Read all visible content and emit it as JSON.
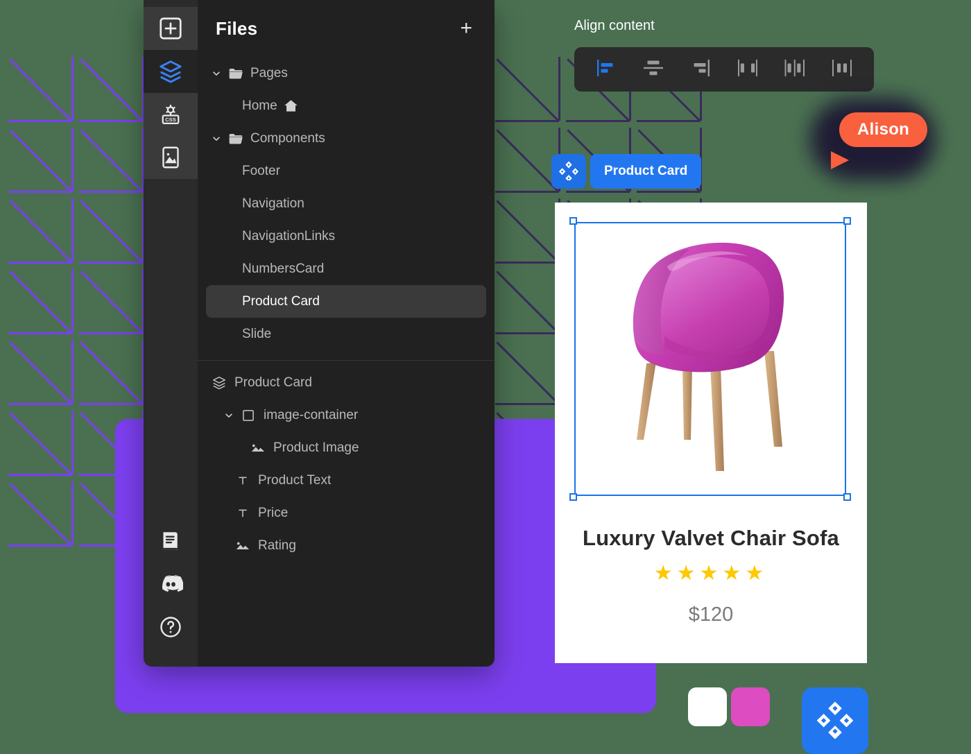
{
  "colors": {
    "canvas_background": "#4a7051",
    "purple_slab": "#7c3fef",
    "panel_background": "#212121",
    "rail_background": "#2b2b2b",
    "accent_blue": "#2277f0",
    "selection_blue": "#1a73e8",
    "cursor_orange": "#f9603e",
    "star_yellow": "#ffc800",
    "swatch_white": "#ffffff",
    "swatch_pink": "#dd4cc0",
    "pattern_left": "#7b3ff2",
    "pattern_right": "#3b2a5c"
  },
  "rail": {
    "items": [
      {
        "icon": "add-plus-box-icon",
        "name": "add-element"
      },
      {
        "icon": "layers-icon",
        "name": "layers",
        "active": true
      },
      {
        "icon": "css-icon",
        "name": "css"
      },
      {
        "icon": "image-icon",
        "name": "assets"
      },
      {
        "icon": "book-icon",
        "name": "docs"
      },
      {
        "icon": "discord-icon",
        "name": "community"
      },
      {
        "icon": "help-circle-icon",
        "name": "help"
      }
    ]
  },
  "panel": {
    "title": "Files",
    "add_button": "+",
    "tree": [
      {
        "label": "Pages",
        "indent": 0,
        "chevron": "down",
        "icon": "folder-icon",
        "selected": false
      },
      {
        "label": "Home",
        "indent": 1,
        "chevron": "none",
        "icon": "none",
        "trailing_icon": "home-icon",
        "selected": false
      },
      {
        "label": "Components",
        "indent": 0,
        "chevron": "down",
        "icon": "folder-icon",
        "selected": false
      },
      {
        "label": "Footer",
        "indent": 1,
        "chevron": "none",
        "icon": "none",
        "selected": false
      },
      {
        "label": "Navigation",
        "indent": 1,
        "chevron": "none",
        "icon": "none",
        "selected": false
      },
      {
        "label": "NavigationLinks",
        "indent": 1,
        "chevron": "none",
        "icon": "none",
        "selected": false
      },
      {
        "label": "NumbersCard",
        "indent": 1,
        "chevron": "none",
        "icon": "none",
        "selected": false
      },
      {
        "label": "Product Card",
        "indent": 1,
        "chevron": "none",
        "icon": "none",
        "selected": true
      },
      {
        "label": "Slide",
        "indent": 1,
        "chevron": "none",
        "icon": "none",
        "selected": false
      }
    ],
    "layers": [
      {
        "label": "Product Card",
        "indent": 0,
        "chevron": "none",
        "icon": "layers-icon"
      },
      {
        "label": "image-container",
        "indent": 1,
        "chevron": "down",
        "icon": "square-icon"
      },
      {
        "label": "Product Image",
        "indent": 2,
        "chevron": "none",
        "icon": "picture-icon"
      },
      {
        "label": "Product Text",
        "indent": 1,
        "chevron": "none",
        "icon": "text-icon"
      },
      {
        "label": "Price",
        "indent": 1,
        "chevron": "none",
        "icon": "text-icon"
      },
      {
        "label": "Rating",
        "indent": 1,
        "chevron": "none",
        "icon": "picture-icon"
      }
    ]
  },
  "align_toolbar": {
    "label": "Align content",
    "buttons": [
      {
        "name": "align-left",
        "icon": "align-left-icon",
        "active": true
      },
      {
        "name": "align-center-vertical",
        "icon": "align-center-icon",
        "active": false
      },
      {
        "name": "align-right",
        "icon": "align-right-icon",
        "active": false
      },
      {
        "name": "distribute-space-between",
        "icon": "space-between-icon",
        "active": false
      },
      {
        "name": "distribute-space-around",
        "icon": "space-around-icon",
        "active": false
      },
      {
        "name": "distribute-space-evenly",
        "icon": "space-evenly-icon",
        "active": false
      }
    ]
  },
  "collaborator": {
    "name": "Alison",
    "cursor_icon": "cursor-arrow-icon"
  },
  "component_chip": {
    "icon": "brand-diamond-icon",
    "label": "Product Card"
  },
  "product_card": {
    "image_alt": "Product Image",
    "title": "Luxury Valvet Chair Sofa",
    "rating_stars": "★★★★★",
    "rating_count": 5,
    "price": "$120"
  },
  "swatches": [
    {
      "name": "swatch-white",
      "color": "#ffffff"
    },
    {
      "name": "swatch-pink",
      "color": "#dd4cc0"
    }
  ],
  "brand_tile": {
    "icon": "brand-diamond-icon",
    "color": "#2277f0"
  }
}
